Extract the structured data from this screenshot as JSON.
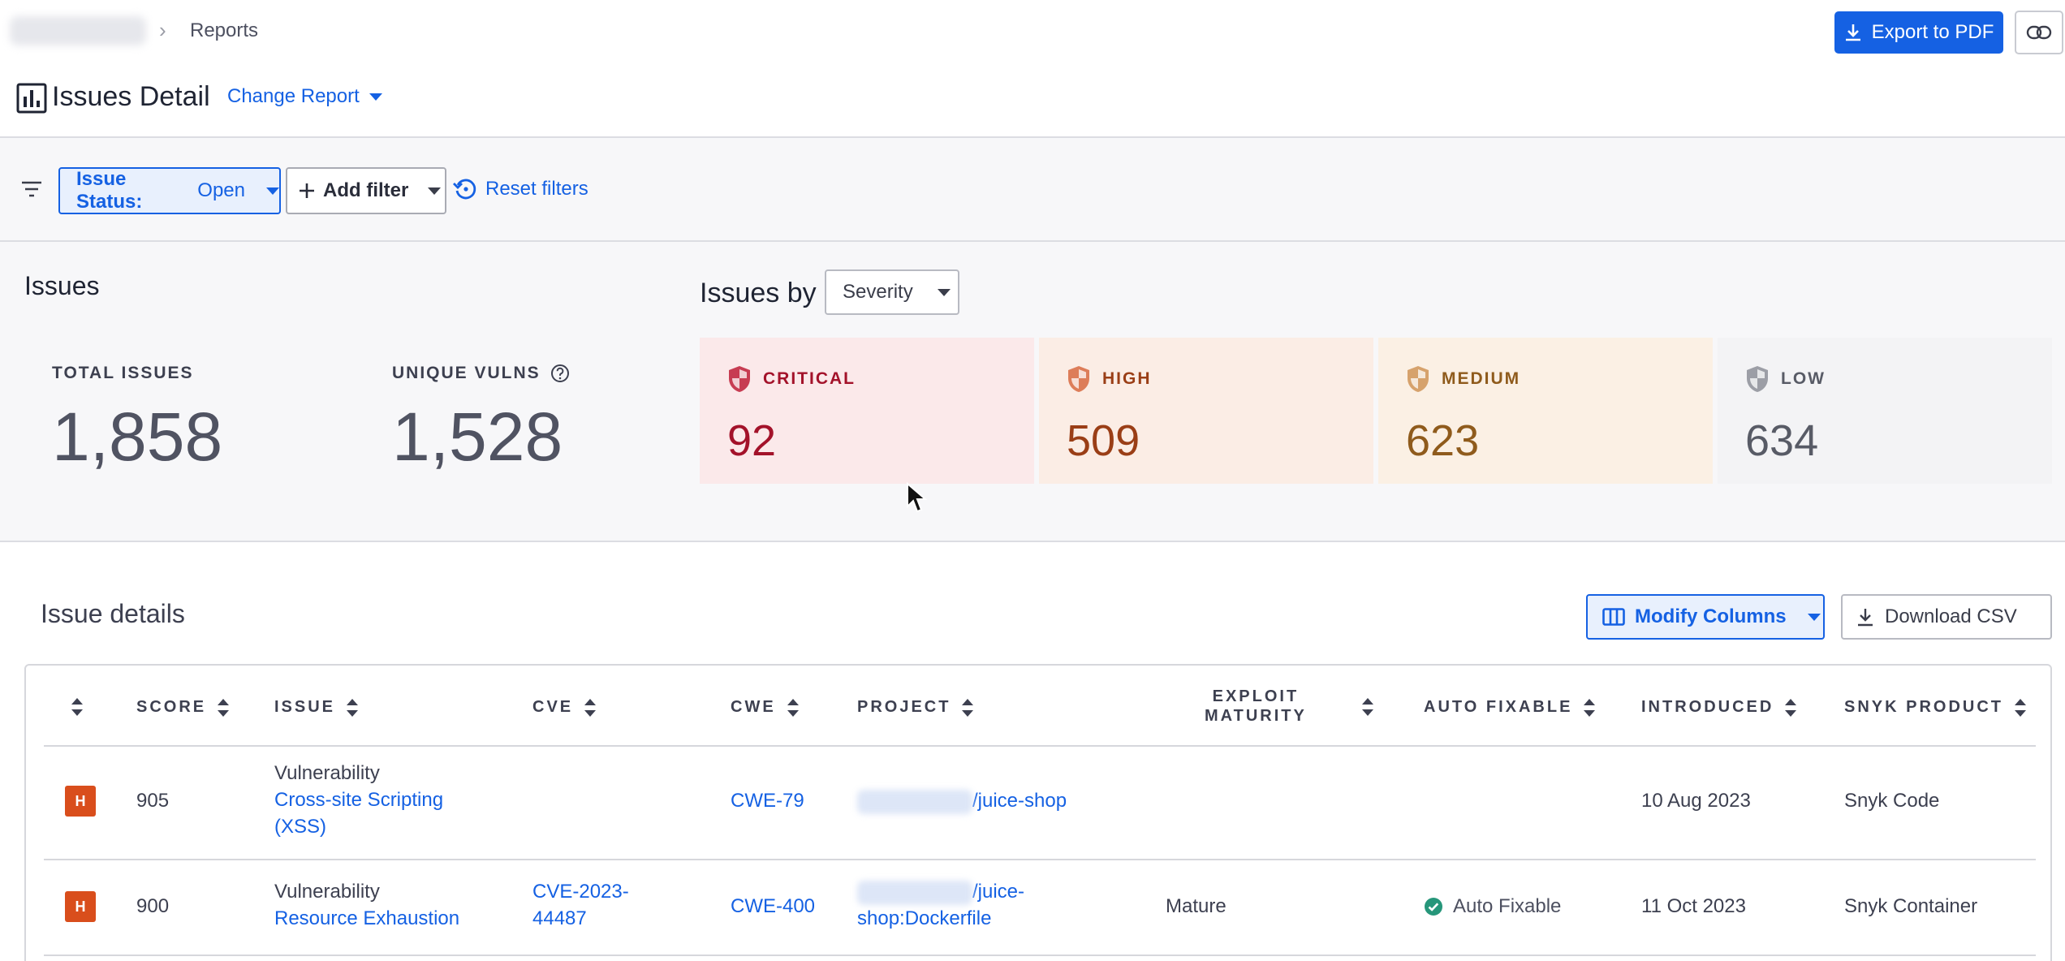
{
  "breadcrumb": {
    "current": "Reports"
  },
  "header": {
    "title": "Issues Detail",
    "change_report": "Change Report",
    "export_label": "Export to PDF"
  },
  "filters": {
    "status_label": "Issue Status:",
    "status_value": "Open",
    "add_filter": "Add filter",
    "reset": "Reset filters"
  },
  "summary": {
    "heading": "Issues",
    "total_label": "TOTAL ISSUES",
    "total_value": "1,858",
    "unique_label": "UNIQUE VULNS",
    "unique_value": "1,528",
    "issues_by_label": "Issues by",
    "issues_by_value": "Severity",
    "severities": [
      {
        "label": "CRITICAL",
        "count": "92",
        "bg": "#fbe9ea",
        "fg": "#a3122a",
        "icon": "#c73c52"
      },
      {
        "label": "HIGH",
        "count": "509",
        "bg": "#fbede5",
        "fg": "#9a3e16",
        "icon": "#dd7d59"
      },
      {
        "label": "MEDIUM",
        "count": "623",
        "bg": "#fbf0e4",
        "fg": "#8f5b1c",
        "icon": "#d6a26c"
      },
      {
        "label": "LOW",
        "count": "634",
        "bg": "#f3f3f5",
        "fg": "#585b66",
        "icon": "#9c9ea6"
      }
    ]
  },
  "details": {
    "heading": "Issue details",
    "modify_columns": "Modify Columns",
    "download_csv": "Download CSV",
    "columns": [
      "SCORE",
      "ISSUE",
      "CVE",
      "CWE",
      "PROJECT",
      "EXPLOIT",
      "MATURITY",
      "AUTO FIXABLE",
      "INTRODUCED",
      "SNYK PRODUCT"
    ],
    "rows": [
      {
        "severity": "H",
        "score": "905",
        "issue_type": "Vulnerability",
        "issue_title_1": "Cross-site Scripting",
        "issue_title_2": "(XSS)",
        "cve_1": "",
        "cve_2": "",
        "cwe": "CWE-79",
        "project_1": "/juice-shop",
        "project_2": "",
        "exploit": "",
        "auto_fixable": "",
        "introduced": "10 Aug 2023",
        "product": "Snyk Code"
      },
      {
        "severity": "H",
        "score": "900",
        "issue_type": "Vulnerability",
        "issue_title_1": "Resource Exhaustion",
        "issue_title_2": "",
        "cve_1": "CVE-2023-",
        "cve_2": "44487",
        "cwe": "CWE-400",
        "project_1": "/juice-",
        "project_2": "shop:Dockerfile",
        "exploit": "Mature",
        "auto_fixable": "Auto Fixable",
        "introduced": "11 Oct 2023",
        "product": "Snyk Container"
      }
    ]
  }
}
